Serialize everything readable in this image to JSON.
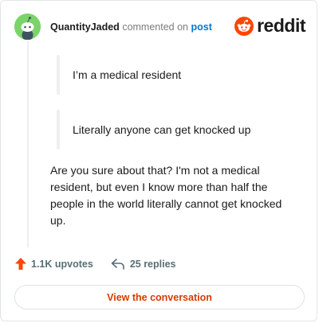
{
  "header": {
    "username": "QuantityJaded",
    "action": "commented on",
    "post_link": "post"
  },
  "brand": {
    "logo_icon": "reddit-snoo-icon",
    "logo_text": "reddit",
    "accent_color": "#ff4500"
  },
  "quotes": [
    "I’m a medical resident",
    "Literally anyone can get knocked up"
  ],
  "comment_body": "Are you sure about that? I'm not a medical resident, but even I know more than half the people in the world literally cannot get knocked up.",
  "stats": {
    "upvotes": "1.1K upvotes",
    "replies": "25 replies"
  },
  "cta": {
    "label": "View the conversation"
  }
}
